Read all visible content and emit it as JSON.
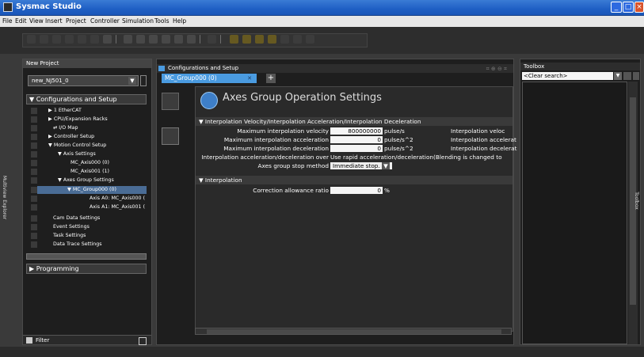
{
  "window": {
    "title": "Sysmac Studio"
  },
  "menu": [
    "File",
    "Edit",
    "View",
    "Insert",
    "Project",
    "Controller",
    "Simulation",
    "Tools",
    "Help"
  ],
  "left_pane": {
    "header": "New Project",
    "project_select": "new_NJ501_0",
    "section_config": "▼ Configurations and Setup",
    "tree": [
      {
        "label": "▶ 𝟙 EtherCAT",
        "indent": 0
      },
      {
        "label": "▶ CPU/Expansion Racks",
        "indent": 0
      },
      {
        "label": "⇄ I/O Map",
        "indent": 0
      },
      {
        "label": "▶ Controller Setup",
        "indent": 0
      },
      {
        "label": "▼ Motion Control Setup",
        "indent": 0
      },
      {
        "label": "▼ Axis Settings",
        "indent": 1
      },
      {
        "label": "MC_Axis000 (0)",
        "indent": 2
      },
      {
        "label": "MC_Axis001 (1)",
        "indent": 2
      },
      {
        "label": "▼ Axes Group Settings",
        "indent": 1
      },
      {
        "label": "▼ MC_Group000 (0)",
        "indent": 2
      },
      {
        "label": "Axis A0: MC_Axis000 (",
        "indent": 3
      },
      {
        "label": "Axis A1: MC_Axis001 (",
        "indent": 3
      },
      {
        "label": "Cam Data Settings",
        "indent": 0
      },
      {
        "label": "Event Settings",
        "indent": 0
      },
      {
        "label": "Task Settings",
        "indent": 0
      },
      {
        "label": "Data Trace Settings",
        "indent": 0
      }
    ],
    "section_programming": "▶ Programming",
    "filter": "Filter",
    "side_tab": "Multiview Explorer"
  },
  "center": {
    "header": "Configurations and Setup",
    "tab": "MC_Group000 (0)",
    "tab_close": "✕",
    "add_tab": "+",
    "page_title": "Axes Group Operation Settings",
    "section1": "▼ Interpolation Velocity/Interpolation Acceleration/Interpolation Deceleration",
    "rows1": [
      {
        "label": "Maximum interpolation velocity",
        "value": "800000000",
        "unit": "pulse/s",
        "right": "Interpolation veloc"
      },
      {
        "label": "Maximum interpolation acceleration",
        "value": "0",
        "unit": "pulse/s^2",
        "right": "Interpolation accelerat"
      },
      {
        "label": "Maximum interpolation deceleration",
        "value": "0",
        "unit": "pulse/s^2",
        "right": "Interpolation decelerat"
      }
    ],
    "override_label": "Interpolation acceleration/deceleration over",
    "override_value": "Use rapid acceleration/deceleration(Blending is changed to",
    "stop_label": "Axes group stop method",
    "stop_value": "Immediate stop.",
    "section2": "▼ Interpolation",
    "correction_label": "Correction allowance ratio",
    "correction_value": "0",
    "correction_unit": "%"
  },
  "toolbox": {
    "header": "Toolbox",
    "search": "<Clear search>",
    "side_tab": "Toolbox"
  }
}
